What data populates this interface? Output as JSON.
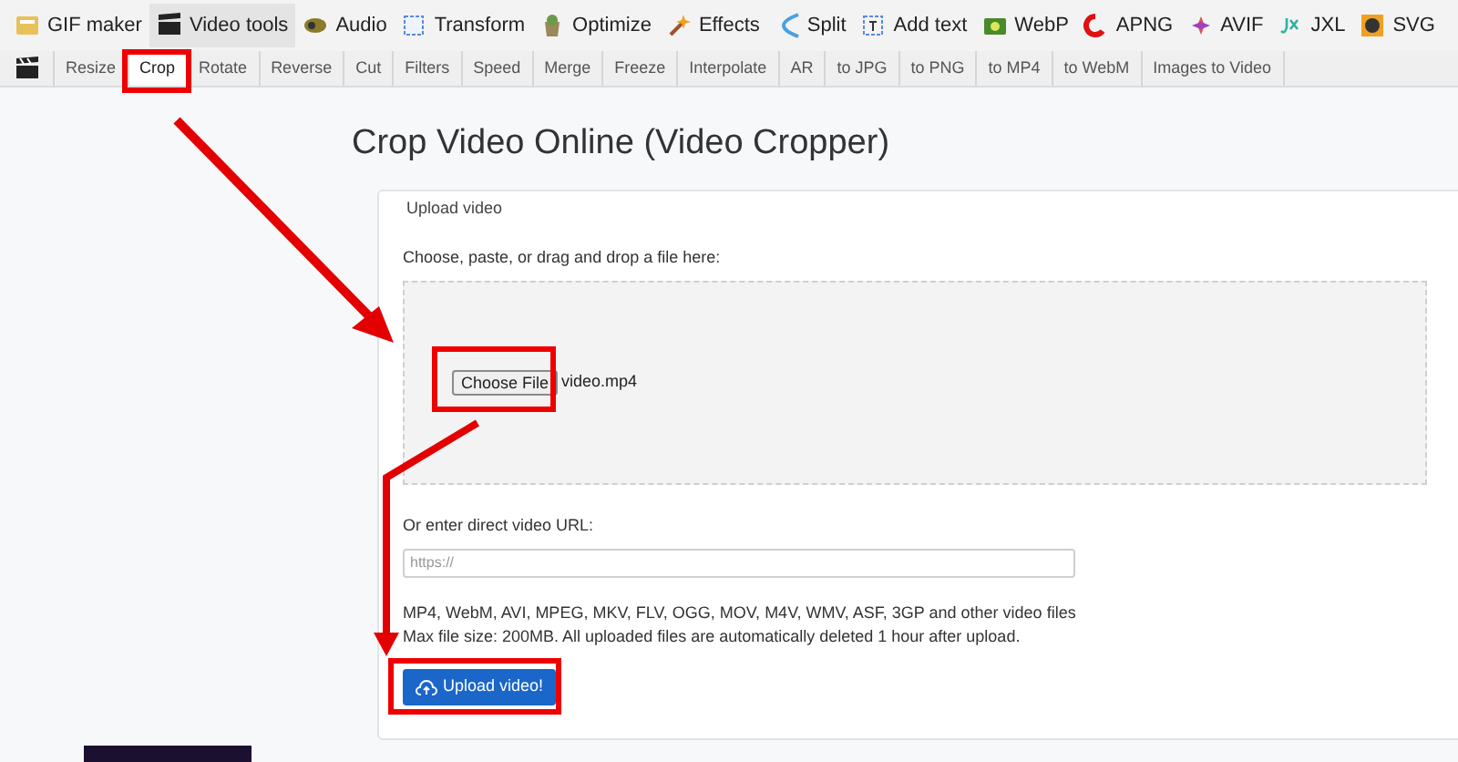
{
  "main_menu": [
    {
      "label": "GIF maker",
      "selected": false
    },
    {
      "label": "Video tools",
      "selected": true
    },
    {
      "label": "Audio",
      "selected": false
    },
    {
      "label": "Transform",
      "selected": false
    },
    {
      "label": "Optimize",
      "selected": false
    },
    {
      "label": "Effects",
      "selected": false
    },
    {
      "label": "Split",
      "selected": false
    },
    {
      "label": "Add text",
      "selected": false
    },
    {
      "label": "WebP",
      "selected": false
    },
    {
      "label": "APNG",
      "selected": false
    },
    {
      "label": "AVIF",
      "selected": false
    },
    {
      "label": "JXL",
      "selected": false
    },
    {
      "label": "SVG",
      "selected": false
    }
  ],
  "sub_menu": [
    {
      "label": "Resize",
      "selected": false
    },
    {
      "label": "Crop",
      "selected": true
    },
    {
      "label": "Rotate",
      "selected": false
    },
    {
      "label": "Reverse",
      "selected": false
    },
    {
      "label": "Cut",
      "selected": false
    },
    {
      "label": "Filters",
      "selected": false
    },
    {
      "label": "Speed",
      "selected": false
    },
    {
      "label": "Merge",
      "selected": false
    },
    {
      "label": "Freeze",
      "selected": false
    },
    {
      "label": "Interpolate",
      "selected": false
    },
    {
      "label": "AR",
      "selected": false
    },
    {
      "label": "to JPG",
      "selected": false
    },
    {
      "label": "to PNG",
      "selected": false
    },
    {
      "label": "to MP4",
      "selected": false
    },
    {
      "label": "to WebM",
      "selected": false
    },
    {
      "label": "Images to Video",
      "selected": false
    }
  ],
  "title": "Crop Video Online (Video Cropper)",
  "upload": {
    "legend": "Upload video",
    "prompt": "Choose, paste, or drag and drop a file here:",
    "choose_button": "Choose File",
    "file_name": "video.mp4",
    "url_label": "Or enter direct video URL:",
    "url_field": {
      "placeholder": "https://"
    },
    "formats_note": "MP4, WebM, AVI, MPEG, MKV, FLV, OGG, MOV, M4V, WMV, ASF, 3GP and other video files",
    "size_note": "Max file size: 200MB. All uploaded files are automatically deleted 1 hour after upload.",
    "upload_button": "Upload video!"
  }
}
